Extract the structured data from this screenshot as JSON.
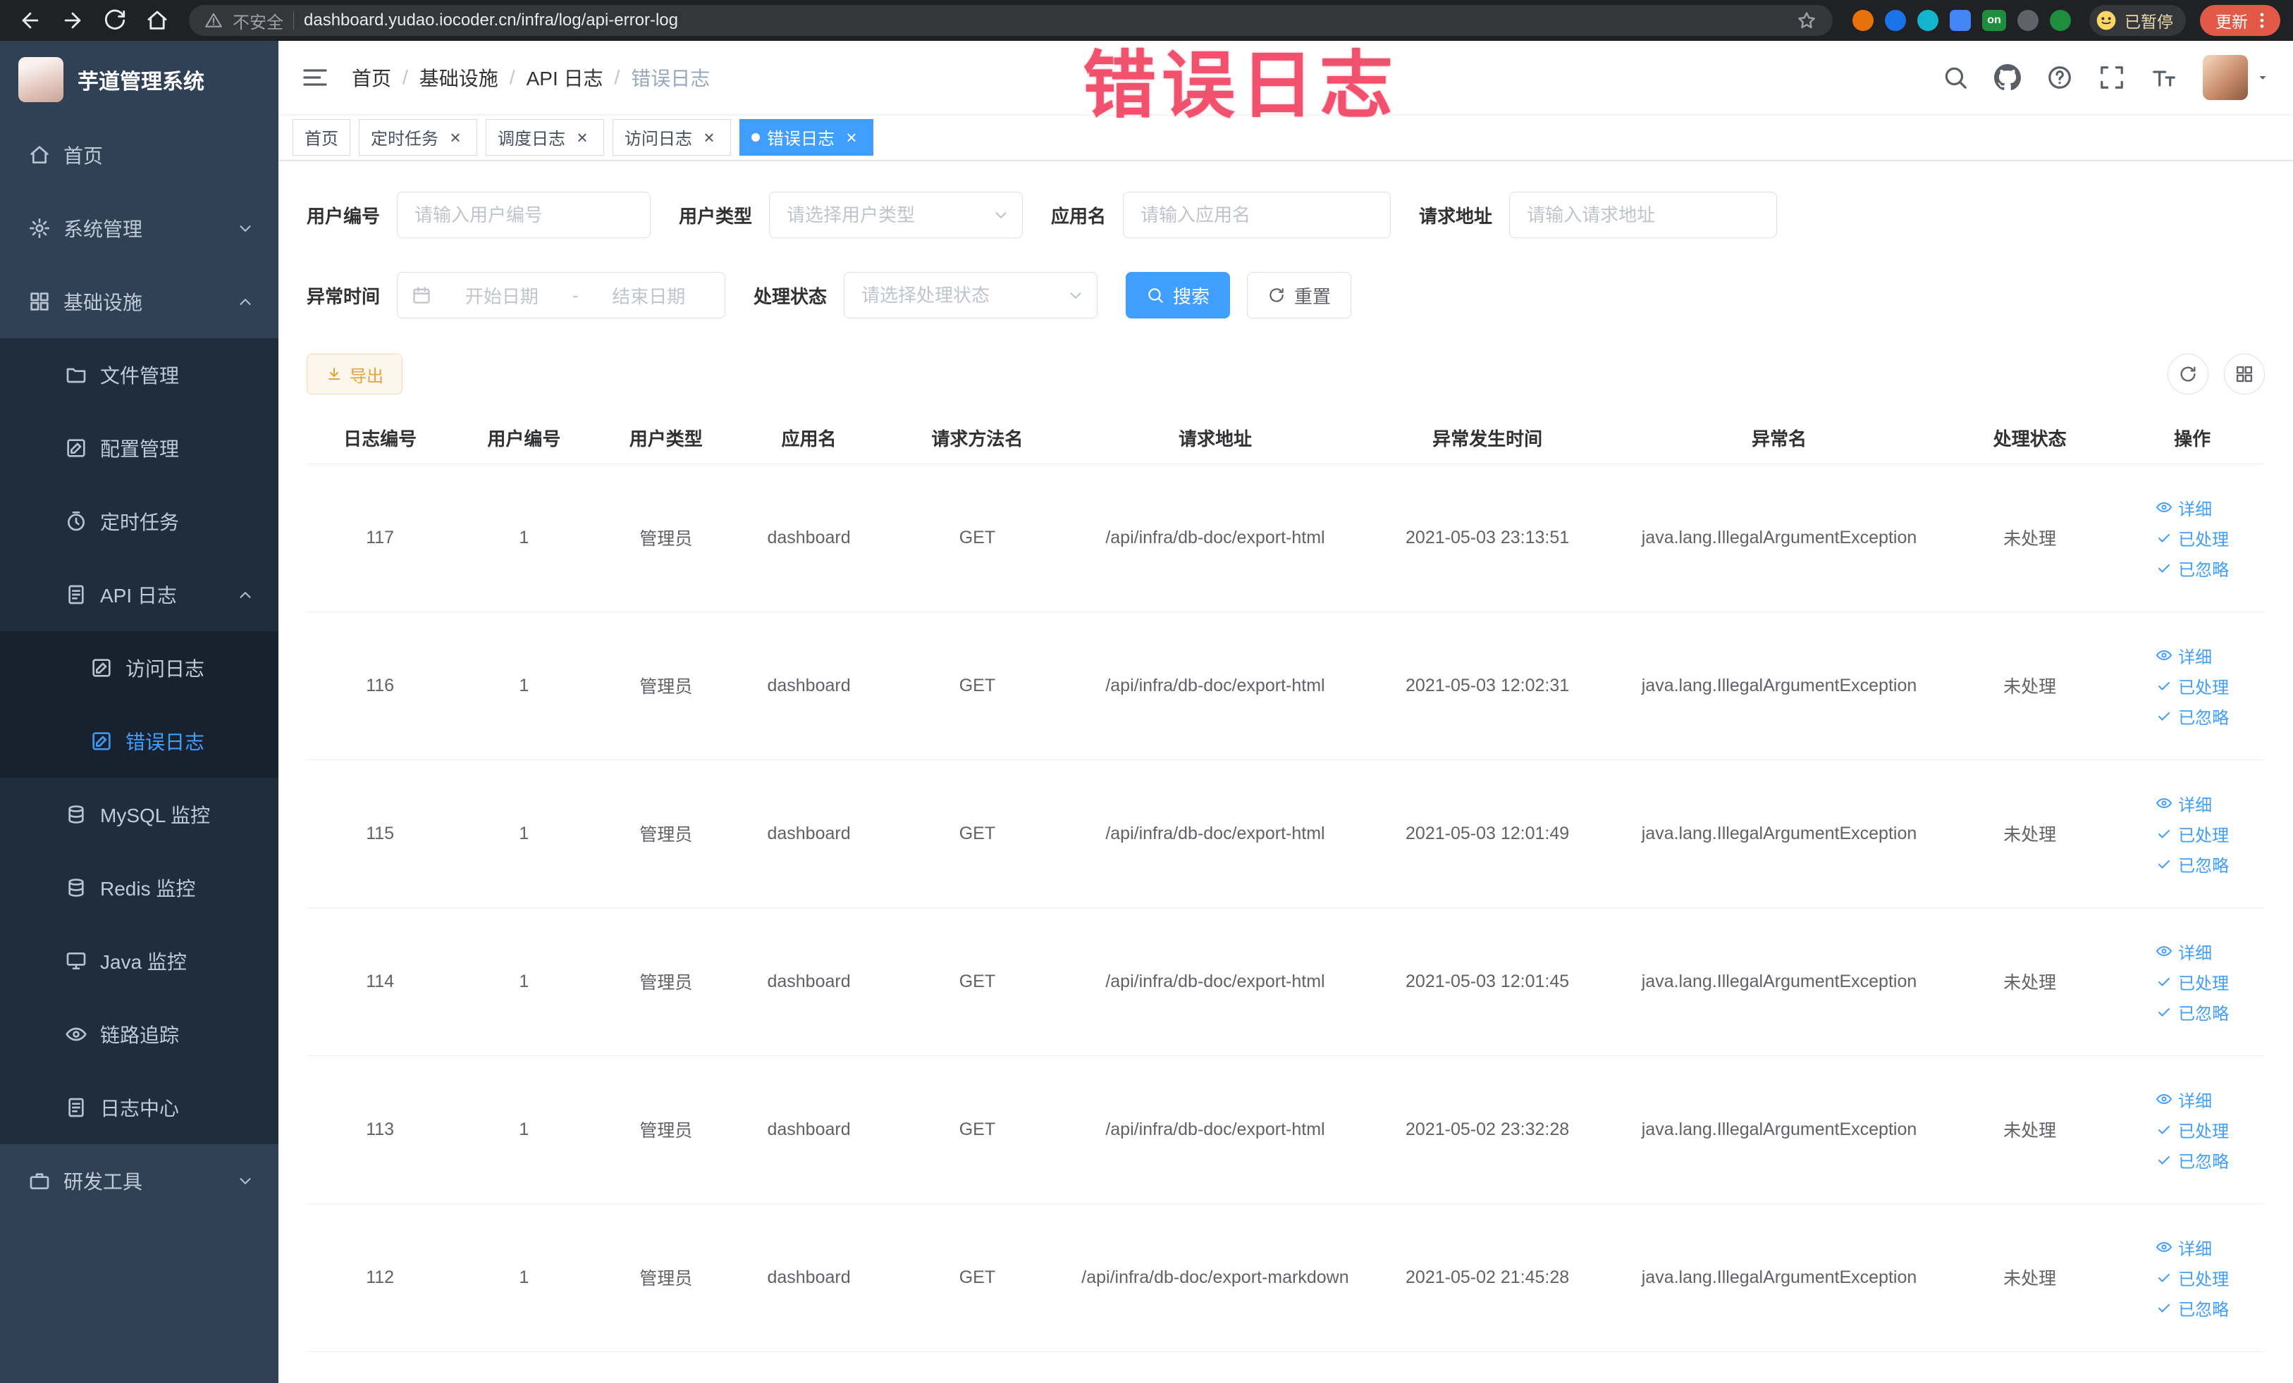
{
  "colors": {
    "accent": "#409eff",
    "warning": "#e6a23c",
    "annotation_pink": "#f2516d",
    "sidebar_bg": "#304156",
    "submenu_bg": "#1f2d3d"
  },
  "browser": {
    "security_label": "不安全",
    "url": "dashboard.yudao.iocoder.cn/infra/log/api-error-log",
    "extension_on_badge": "on",
    "profile_badge": "已暂停",
    "update_button": "更新"
  },
  "annotation": {
    "text": "错误日志"
  },
  "sidebar": {
    "logo_title": "芋道管理系统",
    "items": [
      {
        "label": "首页",
        "icon": "home-icon",
        "level": 1
      },
      {
        "label": "系统管理",
        "icon": "gear-icon",
        "level": 1,
        "chevron": "down"
      },
      {
        "label": "基础设施",
        "icon": "grid-icon",
        "level": 1,
        "chevron": "up"
      },
      {
        "label": "文件管理",
        "icon": "folder-icon",
        "level": 2
      },
      {
        "label": "配置管理",
        "icon": "edit-icon",
        "level": 2
      },
      {
        "label": "定时任务",
        "icon": "timer-icon",
        "level": 2
      },
      {
        "label": "API 日志",
        "icon": "log-icon",
        "level": 2,
        "chevron": "up"
      },
      {
        "label": "访问日志",
        "icon": "doc-icon",
        "level": 3
      },
      {
        "label": "错误日志",
        "icon": "doc-icon",
        "level": 3,
        "active": true
      },
      {
        "label": "MySQL 监控",
        "icon": "database-icon",
        "level": 2
      },
      {
        "label": "Redis 监控",
        "icon": "database-icon",
        "level": 2
      },
      {
        "label": "Java 监控",
        "icon": "monitor-icon",
        "level": 2
      },
      {
        "label": "链路追踪",
        "icon": "trace-icon",
        "level": 2
      },
      {
        "label": "日志中心",
        "icon": "log-icon",
        "level": 2
      },
      {
        "label": "研发工具",
        "icon": "tool-icon",
        "level": 1,
        "chevron": "down"
      }
    ]
  },
  "header": {
    "breadcrumb": [
      "首页",
      "基础设施",
      "API 日志",
      "错误日志"
    ]
  },
  "tabs": [
    {
      "label": "首页",
      "closable": false,
      "active": false
    },
    {
      "label": "定时任务",
      "closable": true,
      "active": false
    },
    {
      "label": "调度日志",
      "closable": true,
      "active": false
    },
    {
      "label": "访问日志",
      "closable": true,
      "active": false
    },
    {
      "label": "错误日志",
      "closable": true,
      "active": true
    }
  ],
  "filters": {
    "user_id": {
      "label": "用户编号",
      "placeholder": "请输入用户编号"
    },
    "user_type": {
      "label": "用户类型",
      "placeholder": "请选择用户类型"
    },
    "app_name": {
      "label": "应用名",
      "placeholder": "请输入应用名"
    },
    "request_url": {
      "label": "请求地址",
      "placeholder": "请输入请求地址"
    },
    "exception_time": {
      "label": "异常时间",
      "start_placeholder": "开始日期",
      "separator": "-",
      "end_placeholder": "结束日期"
    },
    "process_status": {
      "label": "处理状态",
      "placeholder": "请选择处理状态"
    },
    "search_button": "搜索",
    "reset_button": "重置"
  },
  "toolbar": {
    "export_label": "导出"
  },
  "table": {
    "headers": [
      "日志编号",
      "用户编号",
      "用户类型",
      "应用名",
      "请求方法名",
      "请求地址",
      "异常发生时间",
      "异常名",
      "处理状态",
      "操作"
    ],
    "action_labels": [
      "详细",
      "已处理",
      "已忽略"
    ],
    "rows": [
      {
        "id": "117",
        "user_id": "1",
        "user_type": "管理员",
        "app": "dashboard",
        "method": "GET",
        "url": "/api/infra/db-doc/export-html",
        "time": "2021-05-03 23:13:51",
        "exception": "java.lang.IllegalArgumentException",
        "status": "未处理"
      },
      {
        "id": "116",
        "user_id": "1",
        "user_type": "管理员",
        "app": "dashboard",
        "method": "GET",
        "url": "/api/infra/db-doc/export-html",
        "time": "2021-05-03 12:02:31",
        "exception": "java.lang.IllegalArgumentException",
        "status": "未处理"
      },
      {
        "id": "115",
        "user_id": "1",
        "user_type": "管理员",
        "app": "dashboard",
        "method": "GET",
        "url": "/api/infra/db-doc/export-html",
        "time": "2021-05-03 12:01:49",
        "exception": "java.lang.IllegalArgumentException",
        "status": "未处理"
      },
      {
        "id": "114",
        "user_id": "1",
        "user_type": "管理员",
        "app": "dashboard",
        "method": "GET",
        "url": "/api/infra/db-doc/export-html",
        "time": "2021-05-03 12:01:45",
        "exception": "java.lang.IllegalArgumentException",
        "status": "未处理"
      },
      {
        "id": "113",
        "user_id": "1",
        "user_type": "管理员",
        "app": "dashboard",
        "method": "GET",
        "url": "/api/infra/db-doc/export-html",
        "time": "2021-05-02 23:32:28",
        "exception": "java.lang.IllegalArgumentException",
        "status": "未处理"
      },
      {
        "id": "112",
        "user_id": "1",
        "user_type": "管理员",
        "app": "dashboard",
        "method": "GET",
        "url": "/api/infra/db-doc/export-markdown",
        "time": "2021-05-02 21:45:28",
        "exception": "java.lang.IllegalArgumentException",
        "status": "未处理"
      }
    ]
  }
}
